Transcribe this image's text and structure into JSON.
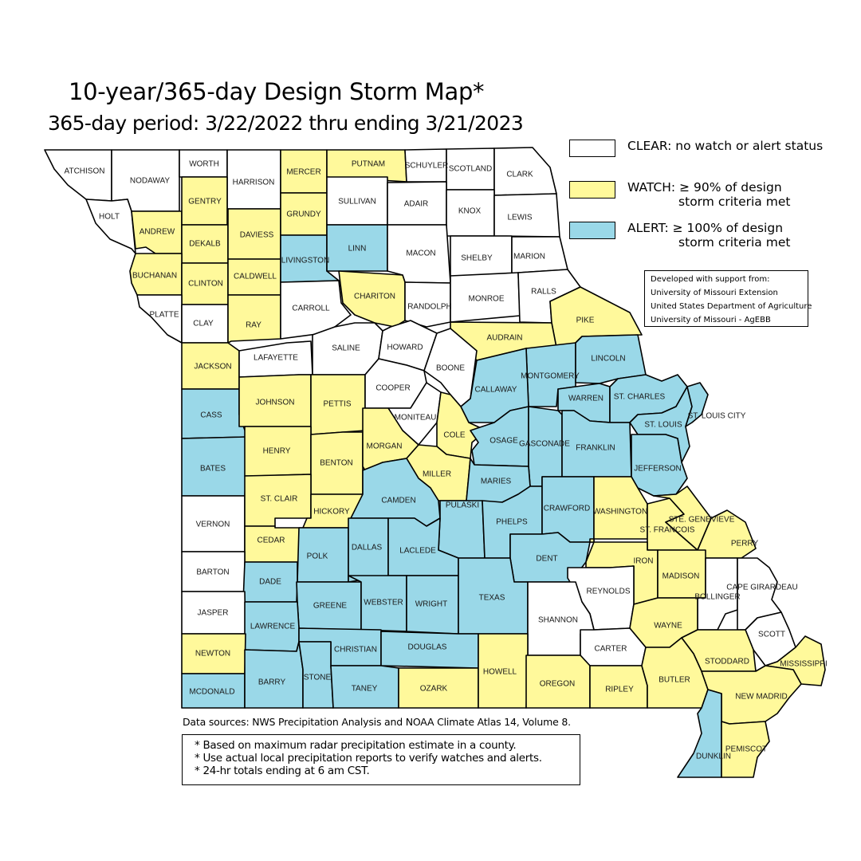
{
  "header": {
    "title": "10-year/365-day Design Storm Map*",
    "subtitle": "365-day period: 3/22/2022 thru ending 3/21/2023"
  },
  "status_colors": {
    "clear": "#ffffff",
    "watch": "#fff99b",
    "alert": "#9ad8e8"
  },
  "legend": [
    {
      "status": "clear",
      "label": "CLEAR: no watch or alert status"
    },
    {
      "status": "watch",
      "label": "WATCH: ≥ 90% of design\n             storm criteria met"
    },
    {
      "status": "alert",
      "label": "ALERT: ≥ 100% of design\n             storm criteria met"
    }
  ],
  "support": {
    "heading": "Developed with support from:",
    "lines": [
      "University of Missouri Extension",
      "United States Department of Agriculture",
      "University of Missouri - AgEBB"
    ]
  },
  "footer": {
    "sources": "Data sources: NWS Precipitation Analysis and NOAA Climate Atlas 14, Volume 8.",
    "notes": [
      "* Based on maximum radar precipitation estimate in a county.",
      "* Use actual local precipitation reports to verify watches and alerts.",
      "* 24-hr totals ending at 6 am CST."
    ]
  },
  "counties": [
    {
      "name": "ATCHISON",
      "status": "clear"
    },
    {
      "name": "NODAWAY",
      "status": "clear"
    },
    {
      "name": "WORTH",
      "status": "clear"
    },
    {
      "name": "HARRISON",
      "status": "clear"
    },
    {
      "name": "MERCER",
      "status": "watch"
    },
    {
      "name": "PUTNAM",
      "status": "watch"
    },
    {
      "name": "SCHUYLER",
      "status": "clear"
    },
    {
      "name": "SCOTLAND",
      "status": "clear"
    },
    {
      "name": "CLARK",
      "status": "clear"
    },
    {
      "name": "HOLT",
      "status": "clear"
    },
    {
      "name": "ANDREW",
      "status": "watch"
    },
    {
      "name": "GENTRY",
      "status": "watch"
    },
    {
      "name": "DEKALB",
      "status": "watch"
    },
    {
      "name": "DAVIESS",
      "status": "watch"
    },
    {
      "name": "GRUNDY",
      "status": "watch"
    },
    {
      "name": "SULLIVAN",
      "status": "clear"
    },
    {
      "name": "ADAIR",
      "status": "clear"
    },
    {
      "name": "KNOX",
      "status": "clear"
    },
    {
      "name": "LEWIS",
      "status": "clear"
    },
    {
      "name": "BUCHANAN",
      "status": "watch"
    },
    {
      "name": "CLINTON",
      "status": "watch"
    },
    {
      "name": "CALDWELL",
      "status": "watch"
    },
    {
      "name": "LIVINGSTON",
      "status": "alert"
    },
    {
      "name": "LINN",
      "status": "alert"
    },
    {
      "name": "MACON",
      "status": "clear"
    },
    {
      "name": "SHELBY",
      "status": "clear"
    },
    {
      "name": "MARION",
      "status": "clear"
    },
    {
      "name": "PLATTE",
      "status": "clear"
    },
    {
      "name": "CLAY",
      "status": "clear"
    },
    {
      "name": "RAY",
      "status": "watch"
    },
    {
      "name": "CARROLL",
      "status": "clear"
    },
    {
      "name": "CHARITON",
      "status": "watch"
    },
    {
      "name": "RANDOLPH",
      "status": "clear"
    },
    {
      "name": "MONROE",
      "status": "clear"
    },
    {
      "name": "RALLS",
      "status": "clear"
    },
    {
      "name": "PIKE",
      "status": "watch"
    },
    {
      "name": "AUDRAIN",
      "status": "watch"
    },
    {
      "name": "JACKSON",
      "status": "watch"
    },
    {
      "name": "LAFAYETTE",
      "status": "clear"
    },
    {
      "name": "SALINE",
      "status": "clear"
    },
    {
      "name": "HOWARD",
      "status": "clear"
    },
    {
      "name": "BOONE",
      "status": "clear"
    },
    {
      "name": "MONTGOMERY",
      "status": "alert"
    },
    {
      "name": "LINCOLN",
      "status": "alert"
    },
    {
      "name": "CALLAWAY",
      "status": "alert"
    },
    {
      "name": "WARREN",
      "status": "alert"
    },
    {
      "name": "ST. CHARLES",
      "status": "alert"
    },
    {
      "name": "ST. LOUIS",
      "status": "alert"
    },
    {
      "name": "ST. LOUIS CITY",
      "status": "alert"
    },
    {
      "name": "CASS",
      "status": "alert"
    },
    {
      "name": "JOHNSON",
      "status": "watch"
    },
    {
      "name": "PETTIS",
      "status": "watch"
    },
    {
      "name": "COOPER",
      "status": "clear"
    },
    {
      "name": "MONITEAU",
      "status": "clear"
    },
    {
      "name": "COLE",
      "status": "watch"
    },
    {
      "name": "OSAGE",
      "status": "alert"
    },
    {
      "name": "GASCONADE",
      "status": "alert"
    },
    {
      "name": "FRANKLIN",
      "status": "alert"
    },
    {
      "name": "JEFFERSON",
      "status": "alert"
    },
    {
      "name": "BATES",
      "status": "alert"
    },
    {
      "name": "HENRY",
      "status": "watch"
    },
    {
      "name": "BENTON",
      "status": "watch"
    },
    {
      "name": "MORGAN",
      "status": "watch"
    },
    {
      "name": "MILLER",
      "status": "watch"
    },
    {
      "name": "MARIES",
      "status": "alert"
    },
    {
      "name": "VERNON",
      "status": "clear"
    },
    {
      "name": "ST. CLAIR",
      "status": "watch"
    },
    {
      "name": "HICKORY",
      "status": "watch"
    },
    {
      "name": "CAMDEN",
      "status": "alert"
    },
    {
      "name": "PULASKI",
      "status": "alert"
    },
    {
      "name": "PHELPS",
      "status": "alert"
    },
    {
      "name": "CRAWFORD",
      "status": "alert"
    },
    {
      "name": "WASHINGTON",
      "status": "watch"
    },
    {
      "name": "ST. FRANCOIS",
      "status": "watch"
    },
    {
      "name": "STE. GENEVIEVE",
      "status": "watch"
    },
    {
      "name": "PERRY",
      "status": "watch"
    },
    {
      "name": "CEDAR",
      "status": "watch"
    },
    {
      "name": "POLK",
      "status": "alert"
    },
    {
      "name": "DALLAS",
      "status": "alert"
    },
    {
      "name": "LACLEDE",
      "status": "alert"
    },
    {
      "name": "DENT",
      "status": "alert"
    },
    {
      "name": "IRON",
      "status": "watch"
    },
    {
      "name": "MADISON",
      "status": "watch"
    },
    {
      "name": "BARTON",
      "status": "clear"
    },
    {
      "name": "DADE",
      "status": "alert"
    },
    {
      "name": "GREENE",
      "status": "alert"
    },
    {
      "name": "WEBSTER",
      "status": "alert"
    },
    {
      "name": "WRIGHT",
      "status": "alert"
    },
    {
      "name": "TEXAS",
      "status": "alert"
    },
    {
      "name": "REYNOLDS",
      "status": "clear"
    },
    {
      "name": "SHANNON",
      "status": "clear"
    },
    {
      "name": "BOLLINGER",
      "status": "clear"
    },
    {
      "name": "CAPE GIRARDEAU",
      "status": "clear"
    },
    {
      "name": "JASPER",
      "status": "clear"
    },
    {
      "name": "LAWRENCE",
      "status": "alert"
    },
    {
      "name": "CHRISTIAN",
      "status": "alert"
    },
    {
      "name": "DOUGLAS",
      "status": "alert"
    },
    {
      "name": "WAYNE",
      "status": "watch"
    },
    {
      "name": "CARTER",
      "status": "clear"
    },
    {
      "name": "SCOTT",
      "status": "clear"
    },
    {
      "name": "NEWTON",
      "status": "watch"
    },
    {
      "name": "STODDARD",
      "status": "watch"
    },
    {
      "name": "MISSISSIPPI",
      "status": "watch"
    },
    {
      "name": "MCDONALD",
      "status": "alert"
    },
    {
      "name": "BARRY",
      "status": "alert"
    },
    {
      "name": "STONE",
      "status": "alert"
    },
    {
      "name": "TANEY",
      "status": "alert"
    },
    {
      "name": "OZARK",
      "status": "watch"
    },
    {
      "name": "HOWELL",
      "status": "watch"
    },
    {
      "name": "OREGON",
      "status": "watch"
    },
    {
      "name": "RIPLEY",
      "status": "watch"
    },
    {
      "name": "BUTLER",
      "status": "watch"
    },
    {
      "name": "NEW MADRID",
      "status": "watch"
    },
    {
      "name": "DUNKLIN",
      "status": "alert"
    },
    {
      "name": "PEMISCOT",
      "status": "watch"
    }
  ]
}
